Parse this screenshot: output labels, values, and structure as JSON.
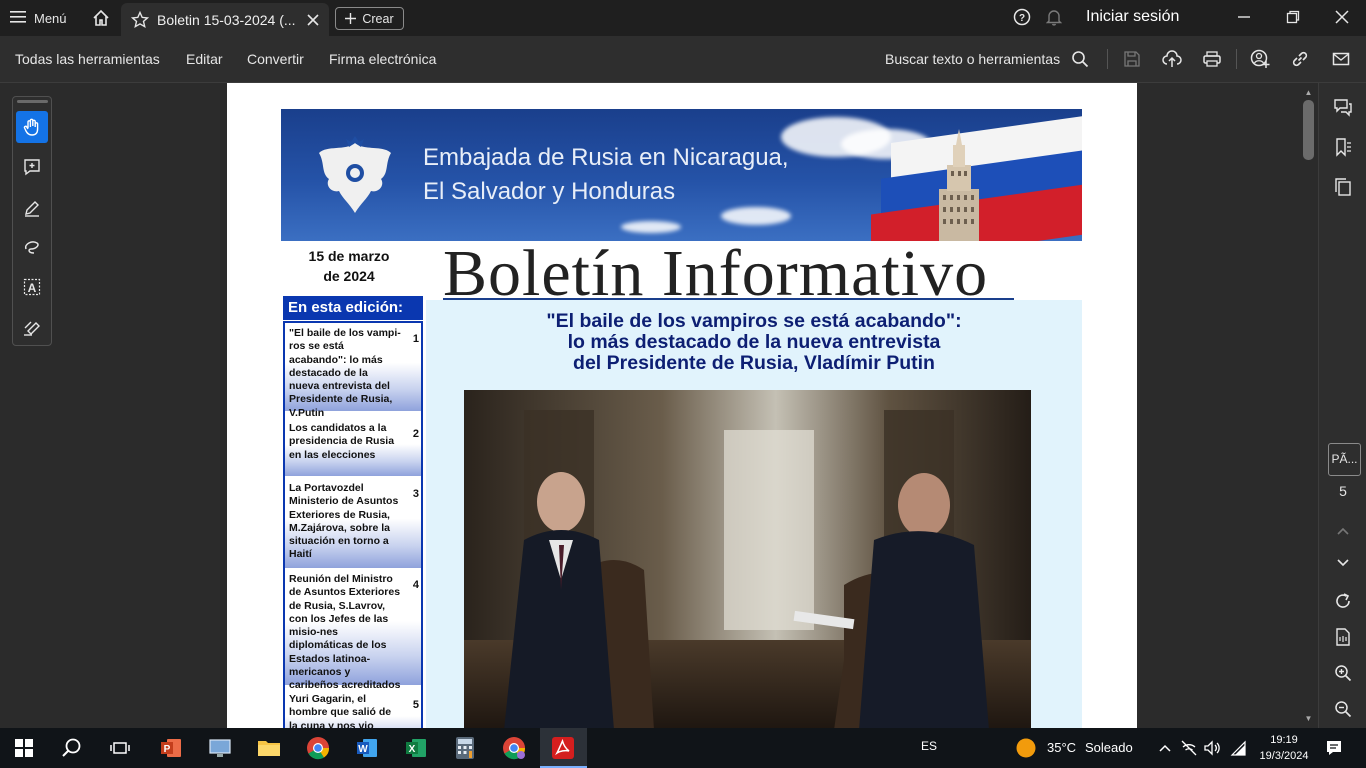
{
  "titlebar": {
    "menu_label": "Menú",
    "tab_title": "Boletin 15-03-2024 (...",
    "create_label": "Crear",
    "login_label": "Iniciar sesión"
  },
  "menubar": {
    "items": [
      "Todas las herramientas",
      "Editar",
      "Convertir",
      "Firma electrónica"
    ],
    "search_label": "Buscar texto o herramientas"
  },
  "document": {
    "banner_line1": "Embajada de Rusia en Nicaragua,",
    "banner_line2": "El Salvador y Honduras",
    "date_line1": "15 de marzo",
    "date_line2": "de 2024",
    "masthead": "Boletín Informativo",
    "edition_heading": "En esta edición:",
    "toc": [
      {
        "text": "\"El baile de los vampi-ros se está acabando\": lo más destacado de la nueva entrevista del Presidente de Rusia, V.Putin",
        "num": "1"
      },
      {
        "text": "Los candidatos a la presidencia de Rusia en las elecciones",
        "num": "2"
      },
      {
        "text": "La Portavozdel Ministerio de Asuntos Exteriores de Rusia, M.Zajárova, sobre la situación en torno a Haití",
        "num": "3"
      },
      {
        "text": "Reunión del Ministro de Asuntos Exteriores de Rusia, S.Lavrov, con los Jefes de las misio-nes diplomáticas de los Estados latinoa-mericanos y caribeños acreditados en Moscú",
        "num": "4"
      },
      {
        "text": "Yuri Gagarin, el hombre que salió de la cuna y nos vio desde las",
        "num": "5"
      }
    ],
    "headline_line1": "\"El baile de los vampiros se está acabando\":",
    "headline_line2": "lo más destacado de la nueva entrevista",
    "headline_line3": "del Presidente de Rusia, Vladímir Putin"
  },
  "rightrail": {
    "page_box": "PÃ...",
    "page_number": "5"
  },
  "taskbar": {
    "language": "ES",
    "weather_temp": "35°C",
    "weather_text": "Soleado",
    "time": "19:19",
    "date": "19/3/2024"
  },
  "colors": {
    "accent": "#1473e6",
    "toc_blue": "#0a37b0",
    "headline_navy": "#0d1f73",
    "article_bg": "#e1f3fc"
  }
}
